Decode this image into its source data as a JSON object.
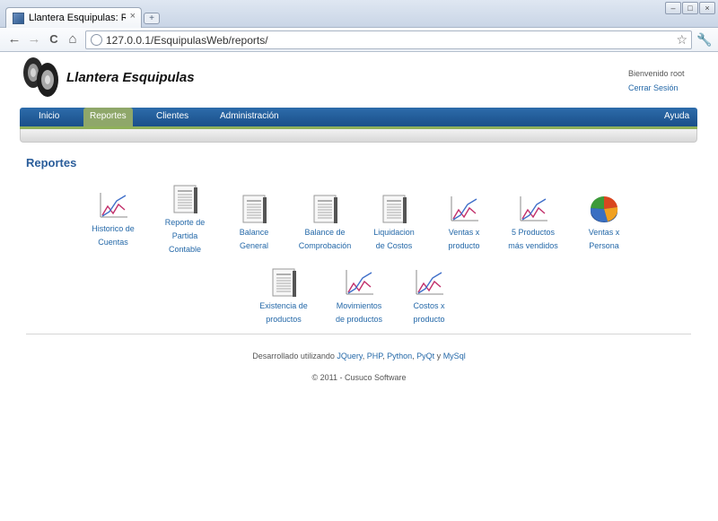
{
  "browser": {
    "tab_title": "Llantera Esquipulas: R...",
    "tab_close": "×",
    "new_tab": "+",
    "url": "127.0.0.1/EsquipulasWeb/reports/",
    "back": "←",
    "forward": "→",
    "reload": "C",
    "home": "⌂",
    "bookmark_star": "☆",
    "wrench": "🔧",
    "window_controls": [
      "–",
      "□",
      "×"
    ]
  },
  "site": {
    "title": "Llantera Esquipulas",
    "welcome": "Bienvenido root",
    "logout": "Cerrar Sesión"
  },
  "nav": {
    "items": [
      "Inicio",
      "Reportes",
      "Clientes",
      "Administración"
    ],
    "active": "Reportes",
    "help": "Ayuda"
  },
  "heading": "Reportes",
  "reports": [
    {
      "lines": [
        "Historico de",
        "Cuentas"
      ],
      "icon": "line-chart-icon"
    },
    {
      "lines": [
        "Reporte de",
        "Partida",
        "Contable"
      ],
      "icon": "document-icon"
    },
    {
      "lines": [
        "Balance",
        "General"
      ],
      "icon": "document-icon"
    },
    {
      "lines": [
        "Balance de",
        "Comprobación"
      ],
      "icon": "document-icon"
    },
    {
      "lines": [
        "Liquidacion",
        "de Costos"
      ],
      "icon": "document-icon"
    },
    {
      "lines": [
        "Ventas x",
        "producto"
      ],
      "icon": "line-chart-icon"
    },
    {
      "lines": [
        "5 Productos",
        "más vendidos"
      ],
      "icon": "line-chart-icon"
    },
    {
      "lines": [
        "Ventas x",
        "Persona"
      ],
      "icon": "pie-chart-icon"
    },
    {
      "lines": [
        "Existencia de",
        "productos"
      ],
      "icon": "document-icon"
    },
    {
      "lines": [
        "Movimientos",
        "de productos"
      ],
      "icon": "line-chart-icon"
    },
    {
      "lines": [
        "Costos x",
        "producto"
      ],
      "icon": "line-chart-icon"
    }
  ],
  "footer": {
    "prefix": "Desarrollado utilizando",
    "tech": [
      "JQuery",
      "PHP",
      "Python",
      "PyQt",
      "MySql"
    ],
    "copyright": "© 2011 - Cusuco Software"
  }
}
